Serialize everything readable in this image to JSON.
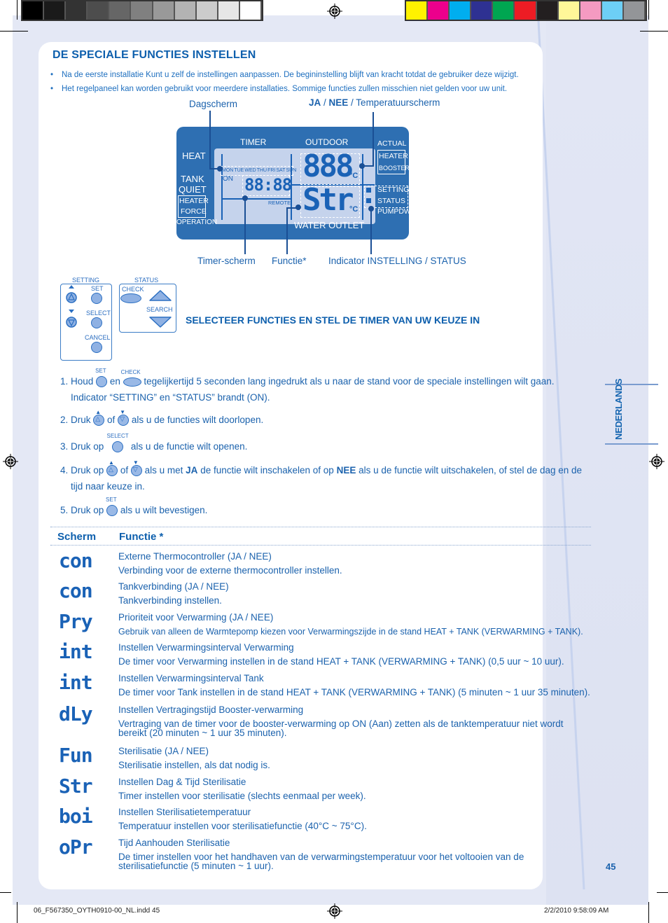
{
  "print_marks": {
    "grayscale_swatches": [
      "#000000",
      "#1a1a1a",
      "#333333",
      "#4d4d4d",
      "#666666",
      "#808080",
      "#999999",
      "#b3b3b3",
      "#cccccc",
      "#e6e6e6",
      "#ffffff"
    ],
    "color_swatches": [
      "#fff200",
      "#ec008c",
      "#00aeef",
      "#2e3192",
      "#00a651",
      "#ed1c24",
      "#231f20",
      "#fff799",
      "#f49ac1",
      "#6dcff6",
      "#939598"
    ]
  },
  "title": "DE SPECIALE FUNCTIES INSTELLEN",
  "bullets": [
    "Na de eerste installatie Kunt u zelf de instellingen aanpassen. De begininstelling blijft van kracht totdat de gebruiker deze wijzigt.",
    "Het regelpaneel kan worden gebruikt voor meerdere installaties. Sommige functies zullen misschien niet gelden voor uw unit."
  ],
  "diagram": {
    "callouts": {
      "dagscherm": "Dagscherm",
      "ja": "JA",
      "sep1": " / ",
      "nee": "NEE",
      "temp": " / Temperatuurscherm",
      "timer_scherm": "Timer-scherm",
      "functie": "Functie*",
      "indicator": "Indicator INSTELLING / STATUS"
    },
    "lcd": {
      "timer": "TIMER",
      "outdoor": "OUTDOOR",
      "actual": "ACTUAL",
      "heater": "HEATER",
      "booster": "BOOSTER",
      "heat": "HEAT",
      "tank": "TANK",
      "quiet": "QUIET",
      "heater_force_1": "HEATER",
      "heater_force_2": "FORCE",
      "operation": "OPERATION",
      "days": [
        "MON",
        "TUE",
        "WED",
        "THU",
        "FRI",
        "SAT",
        "SUN"
      ],
      "on": "ON",
      "time": "88:88",
      "remote": "REMOTE",
      "temp_top": "888",
      "temp_bottom": "Str",
      "unit": "°C",
      "setting": "SETTING",
      "status": "STATUS",
      "pumpdw": "PUMPDW",
      "water_outlet": "WATER OUTLET"
    }
  },
  "button_panel": {
    "setting": "SETTING",
    "status": "STATUS",
    "set": "SET",
    "select": "SELECT",
    "cancel": "CANCEL",
    "check": "CHECK",
    "search": "SEARCH"
  },
  "subtitle": "SELECTEER FUNCTIES EN STEL DE TIMER VAN UW KEUZE IN",
  "steps": {
    "s1_a": "1. Houd",
    "s1_b": "en",
    "s1_c": "tegelijkertijd 5 seconden lang ingedrukt als u naar de stand voor de speciale instellingen wilt gaan.",
    "s1_d": "Indicator “SETTING” en “STATUS” brandt (ON).",
    "s2_a": "2. Druk",
    "s2_b": "of",
    "s2_c": "als u de functies wilt doorlopen.",
    "s3_a": "3. Druk op",
    "s3_b": "als u de functie wilt openen.",
    "s4_a": "4. Druk op",
    "s4_b": "of",
    "s4_c": "als u met",
    "s4_ja": "JA",
    "s4_d": "de functie wilt inschakelen of op",
    "s4_nee": "NEE",
    "s4_e": "als u de functie wilt uitschakelen, of stel de dag en de",
    "s4_f": "tijd naar keuze in.",
    "s5_a": "5. Druk op",
    "s5_b": "als u wilt bevestigen.",
    "cap_set": "SET",
    "cap_check": "CHECK",
    "cap_select": "SELECT"
  },
  "table": {
    "headers": [
      "Scherm",
      "Functie *"
    ],
    "rows": [
      {
        "code": "con",
        "line1": "Externe Thermocontroller (JA / NEE)",
        "line2": "Verbinding voor de externe thermocontroller instellen."
      },
      {
        "code": "con",
        "line1": "Tankverbinding (JA / NEE)",
        "line2": "Tankverbinding instellen."
      },
      {
        "code": "Pry",
        "line1": "Prioriteit voor Verwarming (JA / NEE)",
        "line2": "Gebruik van alleen de Warmtepomp kiezen voor Verwarmingszijde in de stand HEAT + TANK (VERWARMING + TANK)."
      },
      {
        "code": "int",
        "line1": "Instellen Verwarmingsinterval Verwarming",
        "line2": "De timer voor Verwarming instellen in de stand HEAT + TANK (VERWARMING + TANK) (0,5 uur ~ 10 uur)."
      },
      {
        "code": "int",
        "line1": "Instellen Verwarmingsinterval Tank",
        "line2": "De timer voor Tank instellen in de stand HEAT + TANK (VERWARMING + TANK) (5 minuten ~ 1 uur 35 minuten)."
      },
      {
        "code": "dLy",
        "line1": "Instellen Vertragingstijd Booster-verwarming",
        "line2": "Vertraging van de timer voor de booster-verwarming op ON (Aan) zetten als de tanktemperatuur niet wordt",
        "line3": "bereikt (20 minuten ~ 1 uur 35 minuten)."
      },
      {
        "code": "Fun",
        "line1": "Sterilisatie (JA / NEE)",
        "line2": "Sterilisatie instellen, als dat nodig is."
      },
      {
        "code": "Str",
        "line1": "Instellen Dag & Tijd Sterilisatie",
        "line2": "Timer instellen voor sterilisatie (slechts eenmaal per week)."
      },
      {
        "code": "boi",
        "line1": "Instellen Sterilisatietemperatuur",
        "line2": "Temperatuur instellen voor sterilisatiefunctie (40°C ~ 75°C)."
      },
      {
        "code": "oPr",
        "line1": "Tijd Aanhouden Sterilisatie",
        "line2": "De timer instellen voor het handhaven van de verwarmingstemperatuur voor het voltooien van de",
        "line3": "sterilisatiefunctie (5 minuten ~ 1 uur)."
      }
    ]
  },
  "side_tab": "NEDERLANDS",
  "page_number": "45",
  "footer": {
    "file": "06_F567350_OYTH0910-00_NL.indd   45",
    "date": "2/2/2010   9:58:09 AM"
  }
}
